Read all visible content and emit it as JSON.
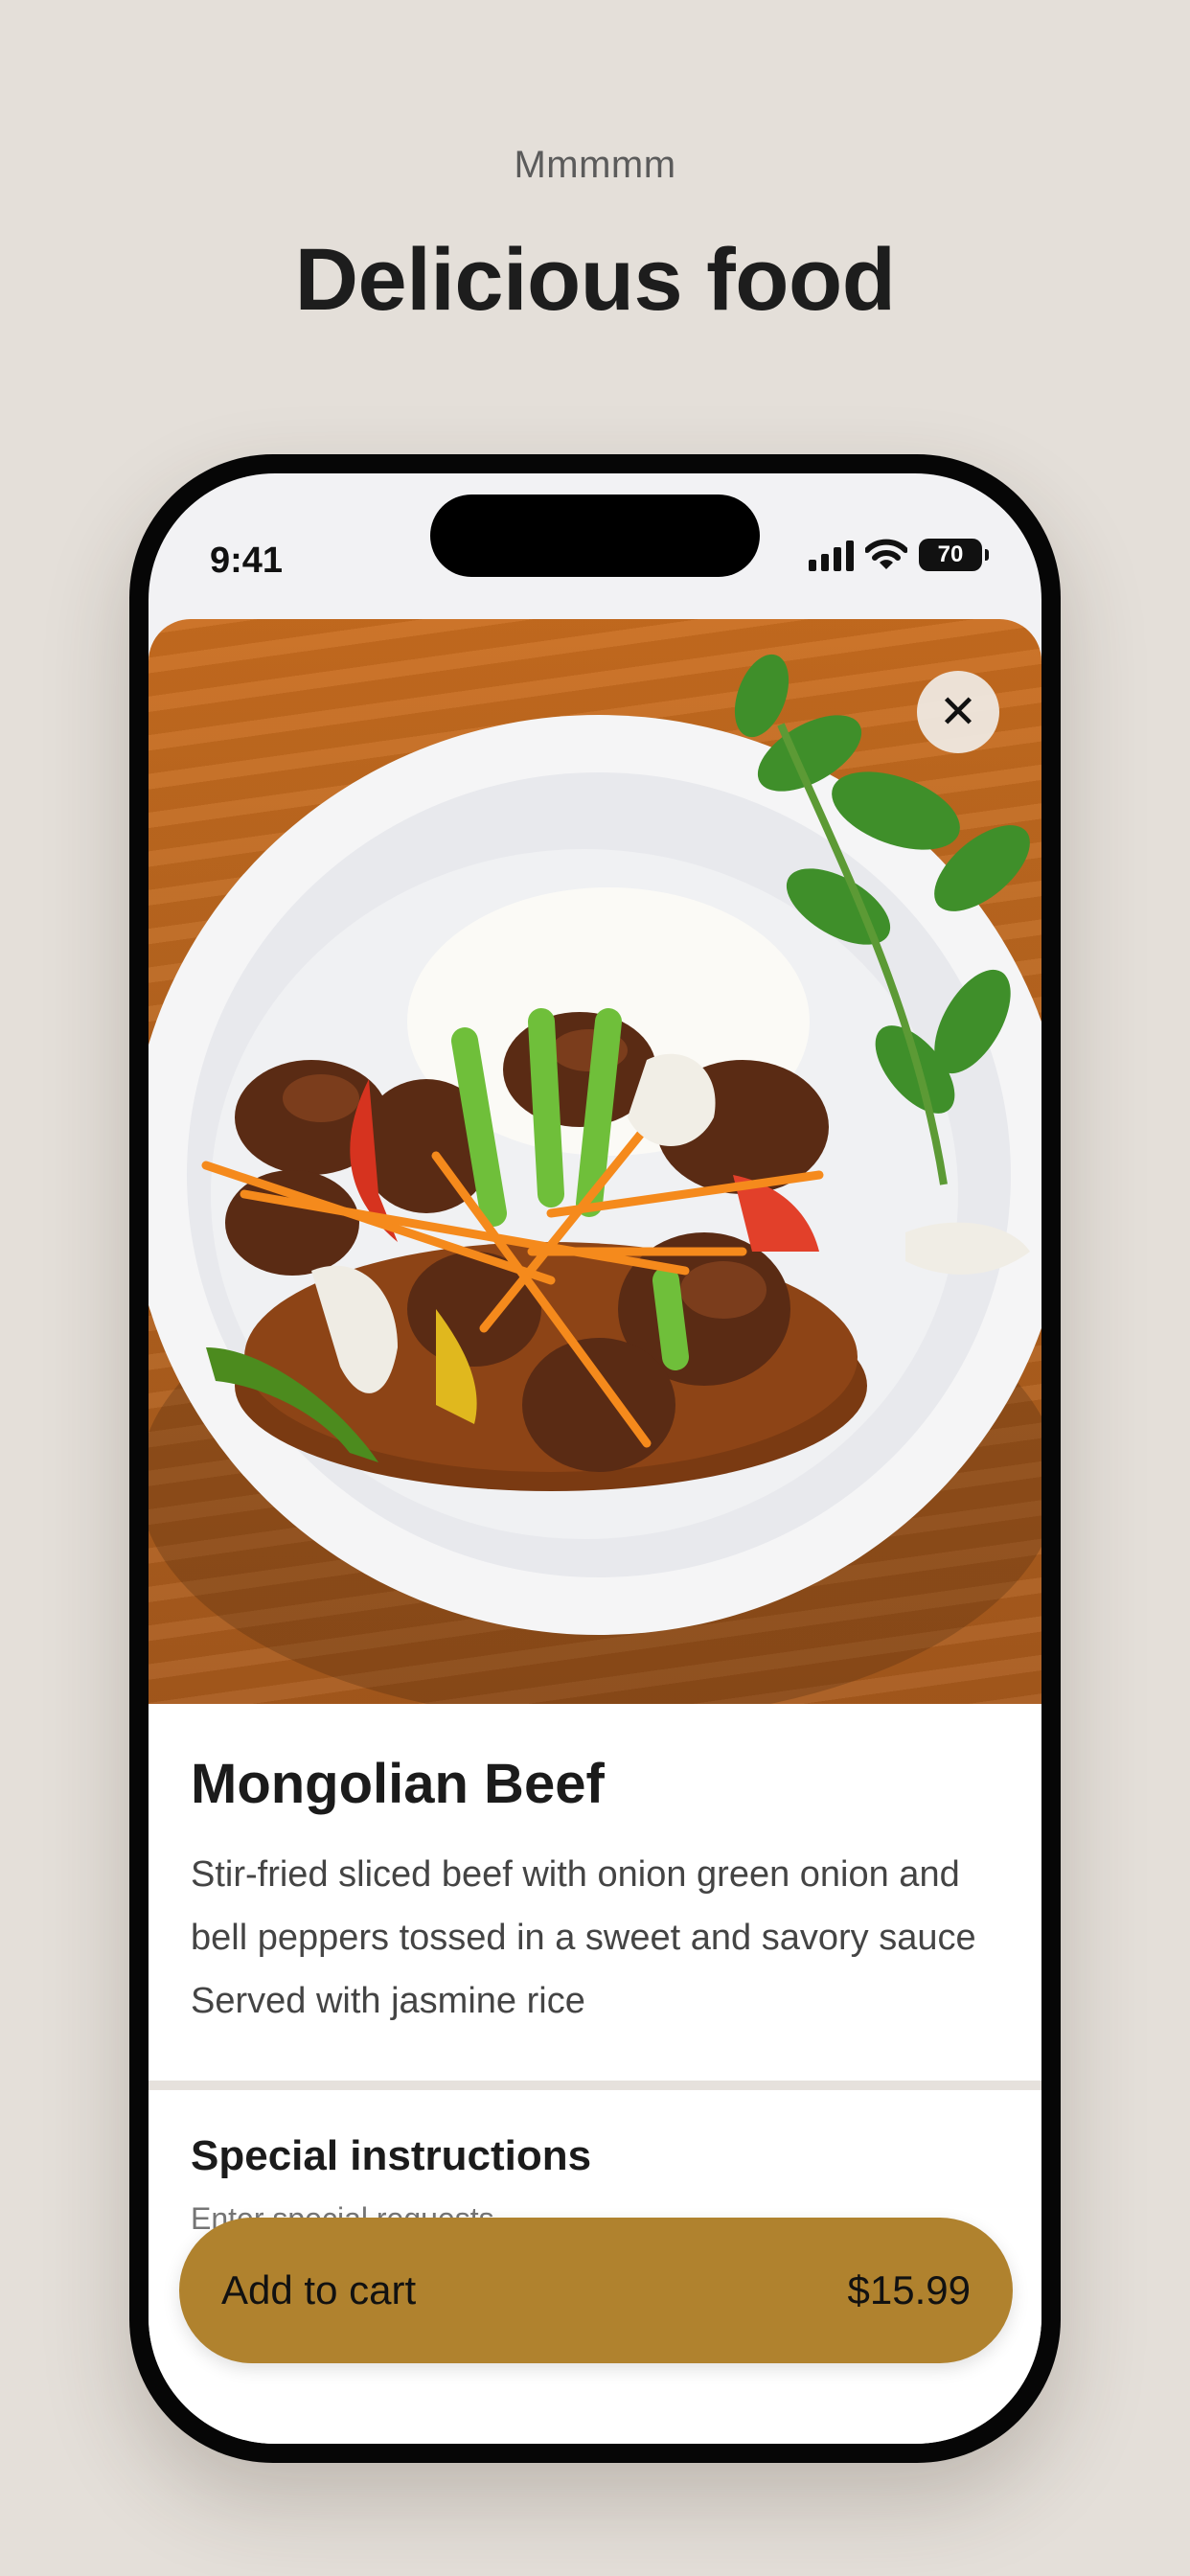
{
  "header": {
    "eyebrow": "Mmmmm",
    "title": "Delicious food"
  },
  "status_bar": {
    "time": "9:41",
    "battery": "70",
    "icons": [
      "cellular-signal-icon",
      "wifi-icon",
      "battery-icon"
    ]
  },
  "dish": {
    "image_icon": "food-photo",
    "name": "Mongolian Beef",
    "description": "Stir-fried sliced beef with onion green onion and bell peppers tossed in a sweet and savory sauce Served with jasmine rice",
    "close_label": "✕"
  },
  "instructions": {
    "title": "Special instructions",
    "placeholder": "Enter special requests"
  },
  "cart": {
    "label": "Add to cart",
    "price": "$15.99"
  },
  "colors": {
    "background": "#e4dfd9",
    "accent": "#b0822e",
    "phone_frame": "#060606"
  }
}
